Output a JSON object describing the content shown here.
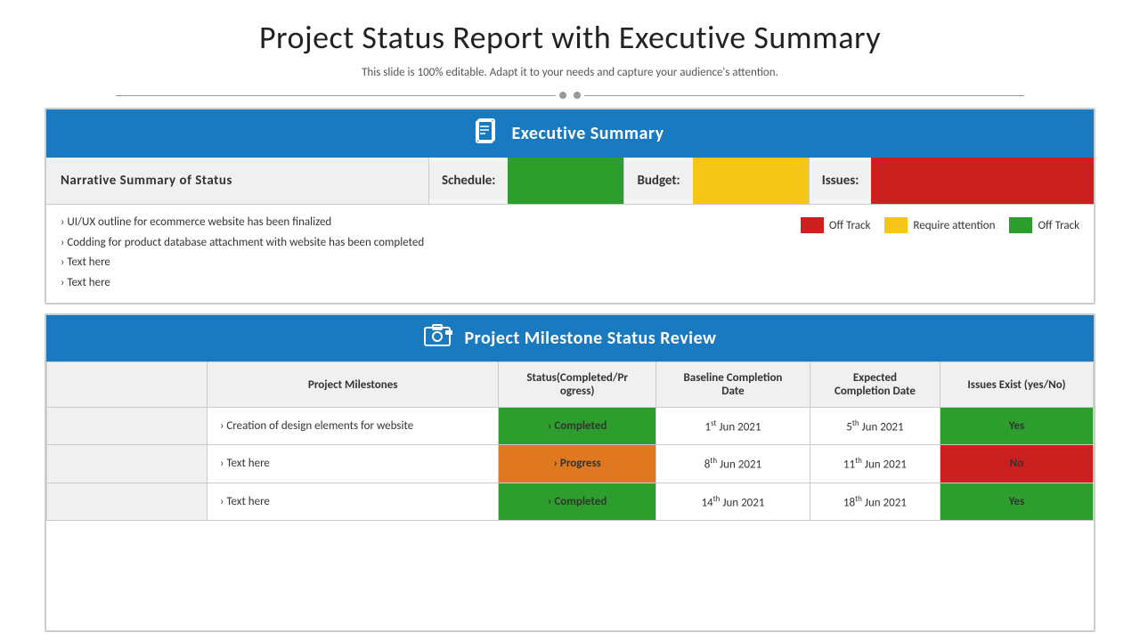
{
  "page": {
    "title": "Project Status Report with Executive Summary",
    "subtitle": "This slide is 100% editable. Adapt it to your needs and capture your audience's attention."
  },
  "executive_summary": {
    "section_title": "Executive Summary",
    "icon": "📋",
    "status_row": {
      "label": "Narrative  Summary  of  Status",
      "schedule_label": "Schedule:",
      "budget_label": "Budget:",
      "issues_label": "Issues:"
    },
    "narrative_bullets": [
      "UI/UX  outline for ecommerce website has been finalized",
      "Codding for product database attachment with website has been completed",
      "Text here",
      "Text here"
    ],
    "legend": [
      {
        "color": "#cc2020",
        "label": "Off Track"
      },
      {
        "color": "#f5c518",
        "label": "Require  attention"
      },
      {
        "color": "#2d9e2d",
        "label": "Off Track"
      }
    ]
  },
  "milestone_review": {
    "section_title": "Project Milestone  Status Review",
    "icon": "📷",
    "columns": {
      "milestones": "Project Milestones",
      "status": "Status(Completed/Progress)",
      "baseline": "Baseline Completion Date",
      "expected": "Expected Completion Date",
      "issues": "Issues Exist (yes/No)"
    },
    "rows": [
      {
        "milestone": "Creation of design elements for website",
        "status": "Completed",
        "status_type": "completed",
        "baseline": [
          "1",
          "st",
          " Jun 2021"
        ],
        "expected": [
          "5",
          "th",
          " Jun 2021"
        ],
        "issues": "Yes",
        "issues_type": "yes"
      },
      {
        "milestone": "Text here",
        "status": "Progress",
        "status_type": "progress",
        "baseline": [
          "8",
          "th",
          " Jun 2021"
        ],
        "expected": [
          "11",
          "th",
          " Jun 2021"
        ],
        "issues": "No",
        "issues_type": "no"
      },
      {
        "milestone": "Text here",
        "status": "Completed",
        "status_type": "completed",
        "baseline": [
          "14",
          "th",
          " Jun 2021"
        ],
        "expected": [
          "18",
          "th",
          " Jun 2021"
        ],
        "issues": "Yes",
        "issues_type": "yes"
      }
    ]
  }
}
